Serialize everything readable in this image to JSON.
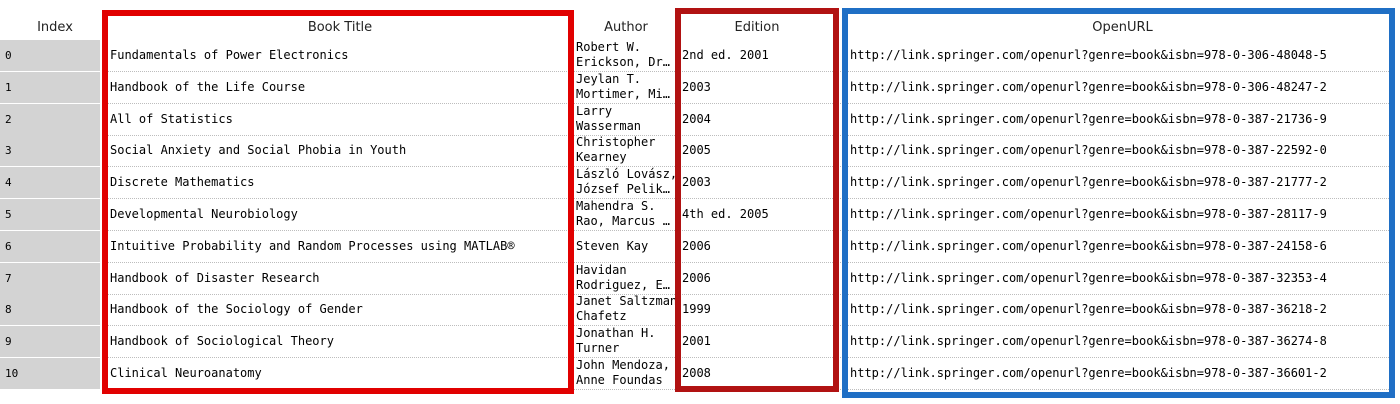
{
  "headers": {
    "index": "Index",
    "title": "Book Title",
    "author": "Author",
    "edition": "Edition",
    "url": "OpenURL"
  },
  "highlight_colors": {
    "title_box": "#e10000",
    "edition_box": "#b11212",
    "url_box": "#1f6fc5",
    "index_background": "#d3d3d3"
  },
  "rows": [
    {
      "index": "0",
      "title": "Fundamentals of Power Electronics",
      "author_line1": "Robert W.",
      "author_line2": "Erickson, Dr…",
      "edition": "2nd ed. 2001",
      "url": "http://link.springer.com/openurl?genre=book&isbn=978-0-306-48048-5"
    },
    {
      "index": "1",
      "title": "Handbook of the Life Course",
      "author_line1": "Jeylan T.",
      "author_line2": "Mortimer, Mi…",
      "edition": "2003",
      "url": "http://link.springer.com/openurl?genre=book&isbn=978-0-306-48247-2"
    },
    {
      "index": "2",
      "title": "All of Statistics",
      "author_line1": "Larry",
      "author_line2": "Wasserman",
      "edition": "2004",
      "url": "http://link.springer.com/openurl?genre=book&isbn=978-0-387-21736-9"
    },
    {
      "index": "3",
      "title": "Social Anxiety and Social Phobia in Youth",
      "author_line1": "Christopher",
      "author_line2": "Kearney",
      "edition": "2005",
      "url": "http://link.springer.com/openurl?genre=book&isbn=978-0-387-22592-0"
    },
    {
      "index": "4",
      "title": "Discrete Mathematics",
      "author_line1": "László Lovász,",
      "author_line2": "József Pelik…",
      "edition": "2003",
      "url": "http://link.springer.com/openurl?genre=book&isbn=978-0-387-21777-2"
    },
    {
      "index": "5",
      "title": "Developmental Neurobiology",
      "author_line1": "Mahendra S.",
      "author_line2": "Rao, Marcus …",
      "edition": "4th ed. 2005",
      "url": "http://link.springer.com/openurl?genre=book&isbn=978-0-387-28117-9"
    },
    {
      "index": "6",
      "title": "Intuitive Probability and Random Processes using MATLAB®",
      "author_line1": "Steven Kay",
      "author_line2": "",
      "edition": "2006",
      "url": "http://link.springer.com/openurl?genre=book&isbn=978-0-387-24158-6"
    },
    {
      "index": "7",
      "title": "Handbook of Disaster Research",
      "author_line1": "Havidan",
      "author_line2": "Rodriguez, E…",
      "edition": "2006",
      "url": "http://link.springer.com/openurl?genre=book&isbn=978-0-387-32353-4"
    },
    {
      "index": "8",
      "title": "Handbook of the Sociology of Gender",
      "author_line1": "Janet Saltzman",
      "author_line2": "Chafetz",
      "edition": "1999",
      "url": "http://link.springer.com/openurl?genre=book&isbn=978-0-387-36218-2"
    },
    {
      "index": "9",
      "title": "Handbook of Sociological Theory",
      "author_line1": "Jonathan H.",
      "author_line2": "Turner",
      "edition": "2001",
      "url": "http://link.springer.com/openurl?genre=book&isbn=978-0-387-36274-8"
    },
    {
      "index": "10",
      "title": "Clinical Neuroanatomy",
      "author_line1": "John Mendoza,",
      "author_line2": "Anne Foundas",
      "edition": "2008",
      "url": "http://link.springer.com/openurl?genre=book&isbn=978-0-387-36601-2"
    }
  ]
}
